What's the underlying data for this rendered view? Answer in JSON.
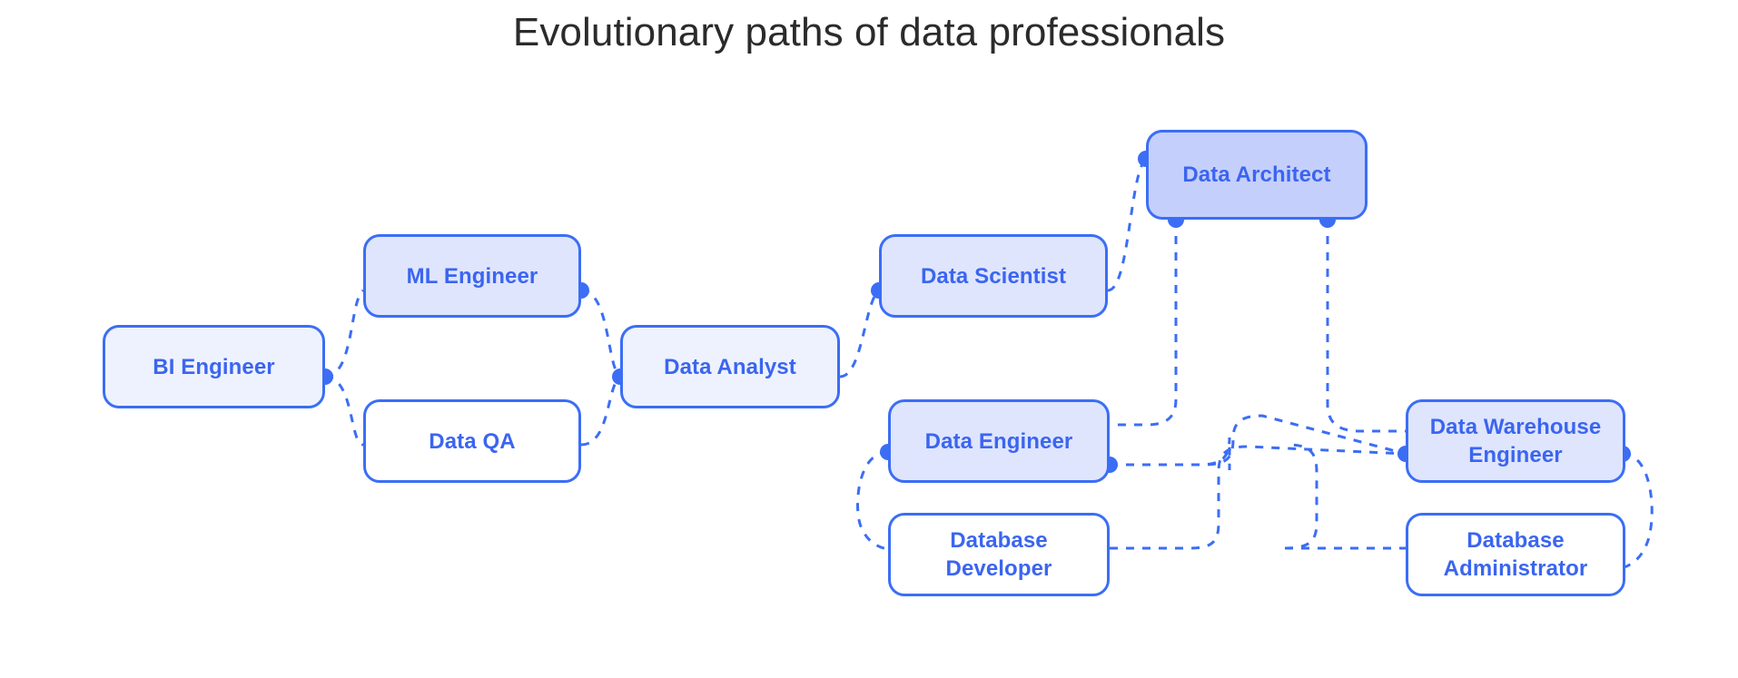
{
  "title": "Evolutionary paths of data professionals",
  "colors": {
    "background": "#ffffff",
    "title_text": "#2b2b2b",
    "node_border": "#3b6ef5",
    "node_text": "#3b65f0",
    "edge_line": "#3b6ef5",
    "edge_dot": "#3b6ef5",
    "fill_none": "#ffffff",
    "fill_light": "#eef2fe",
    "fill_medium": "#dfe5fd",
    "fill_strong": "#c5cffb"
  },
  "nodes": [
    {
      "id": "bi_engineer",
      "label": "BI Engineer",
      "fill": "light"
    },
    {
      "id": "ml_engineer",
      "label": "ML Engineer",
      "fill": "medium"
    },
    {
      "id": "data_qa",
      "label": "Data QA",
      "fill": "none"
    },
    {
      "id": "data_analyst",
      "label": "Data Analyst",
      "fill": "light"
    },
    {
      "id": "data_scientist",
      "label": "Data Scientist",
      "fill": "medium"
    },
    {
      "id": "data_architect",
      "label": "Data Architect",
      "fill": "strong"
    },
    {
      "id": "data_engineer",
      "label": "Data Engineer",
      "fill": "medium"
    },
    {
      "id": "database_developer",
      "label": "Database\nDeveloper",
      "fill": "none"
    },
    {
      "id": "data_warehouse_engineer",
      "label": "Data Warehouse\nEngineer",
      "fill": "medium"
    },
    {
      "id": "database_administrator",
      "label": "Database\nAdministrator",
      "fill": "none"
    }
  ],
  "edges": [
    {
      "from": "bi_engineer",
      "to": "ml_engineer"
    },
    {
      "from": "bi_engineer",
      "to": "data_qa"
    },
    {
      "from": "ml_engineer",
      "to": "data_analyst"
    },
    {
      "from": "data_qa",
      "to": "data_analyst"
    },
    {
      "from": "data_analyst",
      "to": "data_scientist"
    },
    {
      "from": "data_scientist",
      "to": "data_architect"
    },
    {
      "from": "data_architect",
      "to": "data_engineer"
    },
    {
      "from": "data_architect",
      "to": "data_warehouse_engineer"
    },
    {
      "from": "data_engineer",
      "to": "database_developer"
    },
    {
      "from": "data_engineer",
      "to": "data_warehouse_engineer"
    },
    {
      "from": "database_developer",
      "to": "data_warehouse_engineer"
    },
    {
      "from": "data_warehouse_engineer",
      "to": "database_administrator"
    }
  ],
  "chart_data": {
    "type": "diagram",
    "title": "Evolutionary paths of data professionals",
    "node_count": 10,
    "edge_count": 12,
    "levels": [
      [
        "BI Engineer"
      ],
      [
        "ML Engineer",
        "Data QA"
      ],
      [
        "Data Analyst"
      ],
      [
        "Data Scientist",
        "Data Engineer",
        "Database Developer"
      ],
      [
        "Data Architect",
        "Data Warehouse Engineer",
        "Database Administrator"
      ]
    ]
  }
}
